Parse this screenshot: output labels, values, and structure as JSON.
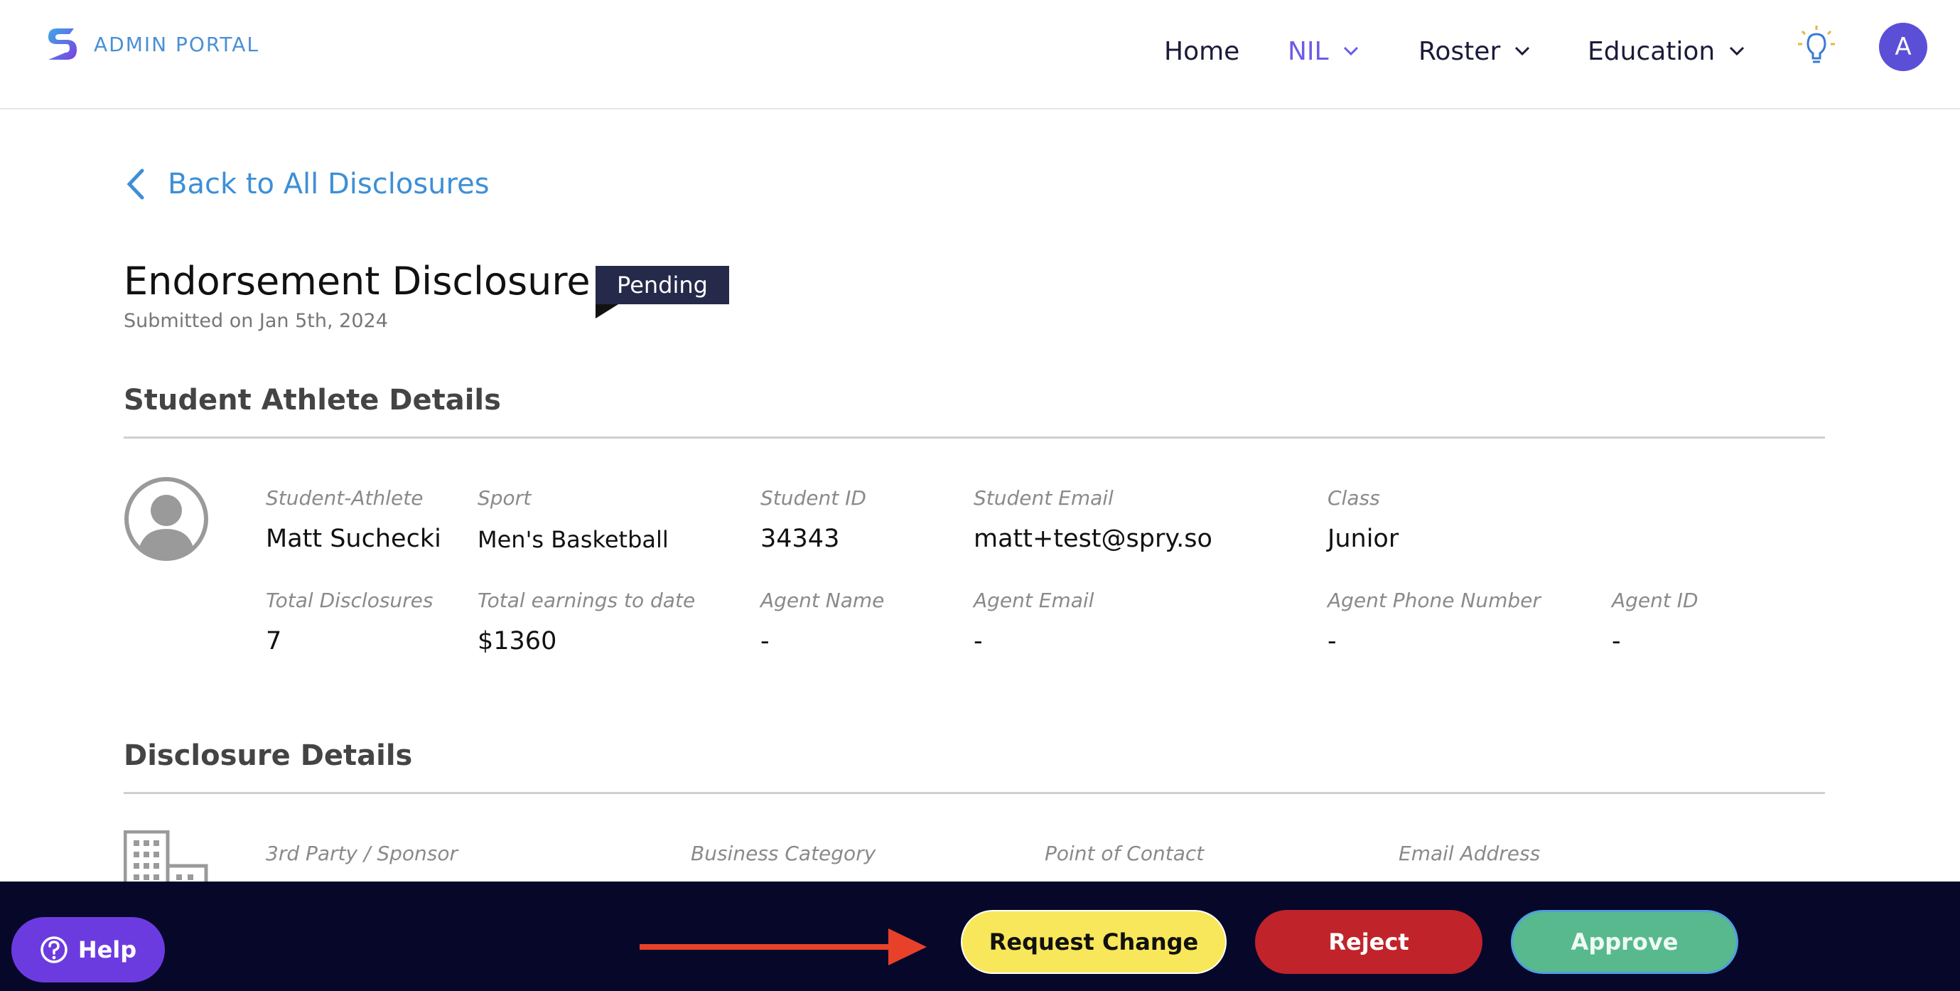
{
  "header": {
    "logo_text": "ADMIN PORTAL",
    "nav": [
      {
        "label": "Home"
      },
      {
        "label": "NIL"
      },
      {
        "label": "Roster"
      },
      {
        "label": "Education"
      }
    ],
    "avatar_initial": "A",
    "accent_color": "#6c5ce7"
  },
  "back_link": "Back to All Disclosures",
  "page": {
    "title": "Endorsement Disclosure",
    "status_badge": "Pending",
    "submitted": "Submitted on Jan 5th, 2024"
  },
  "student_section": {
    "title": "Student Athlete Details",
    "fields": [
      {
        "label": "Student-Athlete",
        "value": "Matt Suchecki"
      },
      {
        "label": "Sport",
        "value": "Men's Basketball"
      },
      {
        "label": "Student ID",
        "value": "34343"
      },
      {
        "label": "Student Email",
        "value": "matt+test@spry.so"
      },
      {
        "label": "Class",
        "value": "Junior"
      },
      {
        "label": "Total Disclosures",
        "value": "7"
      },
      {
        "label": "Total earnings to date",
        "value": "$1360"
      },
      {
        "label": "Agent Name",
        "value": "-"
      },
      {
        "label": "Agent Email",
        "value": "-"
      },
      {
        "label": "Agent Phone Number",
        "value": "-"
      },
      {
        "label": "Agent ID",
        "value": "-"
      }
    ]
  },
  "disclosure_section": {
    "title": "Disclosure Details",
    "fields": [
      {
        "label": "3rd Party / Sponsor"
      },
      {
        "label": "Business Category"
      },
      {
        "label": "Point of Contact"
      },
      {
        "label": "Email Address"
      }
    ]
  },
  "footer": {
    "help_label": "Help",
    "request_change_label": "Request Change",
    "reject_label": "Reject",
    "approve_label": "Approve"
  },
  "icons": [
    "logo-icon",
    "chevron-down-icon",
    "lightbulb-icon",
    "chevron-left-icon",
    "user-avatar-icon",
    "building-icon",
    "help-icon",
    "arrow-right-icon"
  ]
}
